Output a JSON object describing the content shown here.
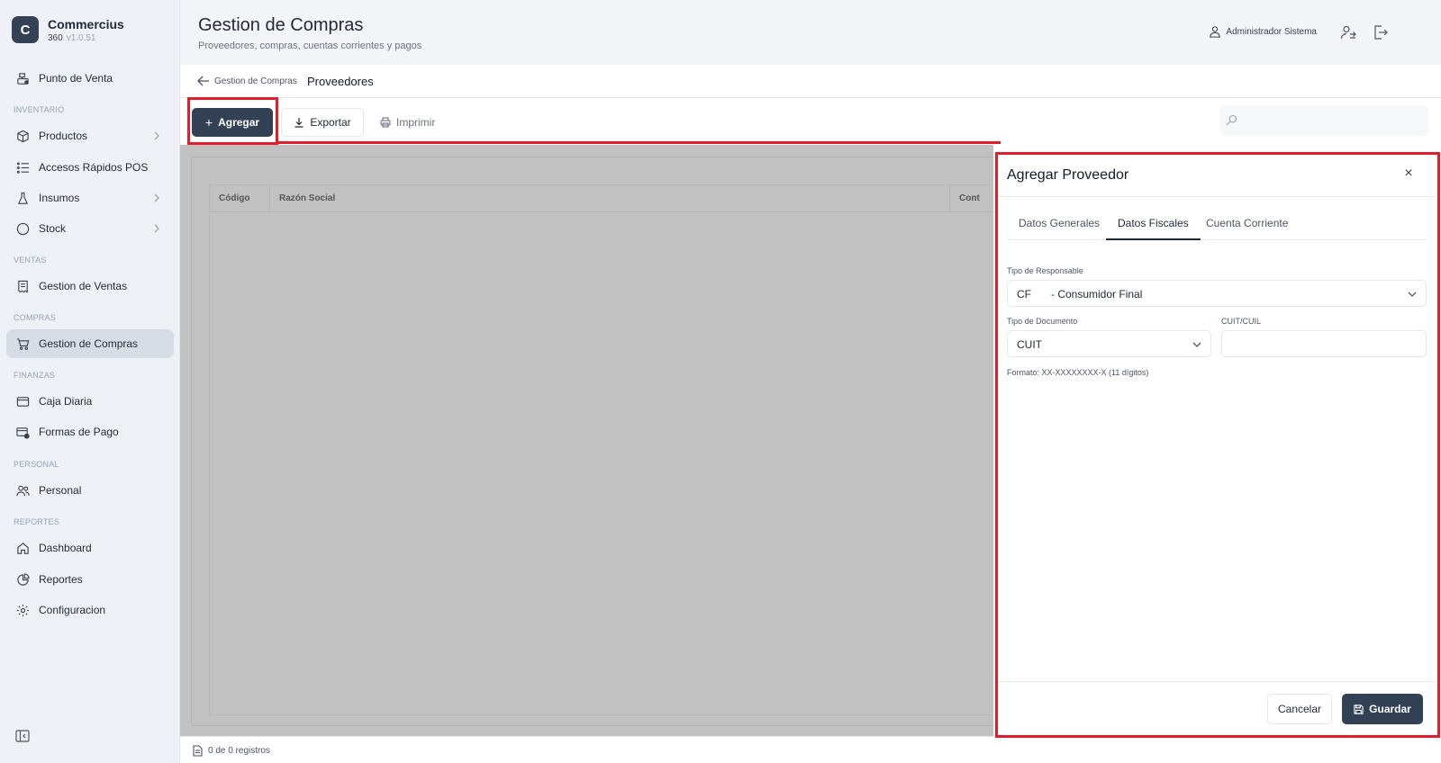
{
  "brand": {
    "initial": "C",
    "name": "Commercius",
    "edition": "360",
    "version": "v1.0.51"
  },
  "sidebar": {
    "point_of_sale": "Punto de Venta",
    "sections": {
      "inventario": "INVENTARIO",
      "ventas": "VENTAS",
      "compras": "COMPRAS",
      "finanzas": "FINANZAS",
      "personal": "PERSONAL",
      "reportes": "REPORTES"
    },
    "items": {
      "productos": "Productos",
      "accesos_rapidos": "Accesos Rápidos POS",
      "insumos": "Insumos",
      "stock": "Stock",
      "gestion_ventas": "Gestion de Ventas",
      "gestion_compras": "Gestion de Compras",
      "caja_diaria": "Caja Diaria",
      "formas_pago": "Formas de Pago",
      "personal": "Personal",
      "dashboard": "Dashboard",
      "reportes": "Reportes",
      "configuracion": "Configuracion"
    },
    "active_item": "gestion_compras"
  },
  "header": {
    "title": "Gestion de Compras",
    "subtitle": "Proveedores, compras, cuentas corrientes y pagos",
    "user_name": "Administrador Sistema"
  },
  "breadcrumb": {
    "back_label": "Gestion de Compras",
    "current": "Proveedores"
  },
  "toolbar": {
    "add_label": "Agregar",
    "export_label": "Exportar",
    "print_label": "Imprimir",
    "search_placeholder": ""
  },
  "table": {
    "columns": [
      "Código",
      "Razón Social",
      "Cont"
    ]
  },
  "footer": {
    "records_text": "0 de 0 registros"
  },
  "drawer": {
    "title": "Agregar Proveedor",
    "close_symbol": "×",
    "tabs": [
      "Datos Generales",
      "Datos Fiscales",
      "Cuenta Corriente"
    ],
    "active_tab": "Datos Fiscales",
    "fields": {
      "tipo_responsable_label": "Tipo de Responsable",
      "tipo_responsable_code": "CF",
      "tipo_responsable_desc": "- Consumidor Final",
      "tipo_documento_label": "Tipo de Documento",
      "tipo_documento_value": "CUIT",
      "cuit_label": "CUIT/CUIL",
      "cuit_value": "",
      "format_hint": "Formato: XX-XXXXXXXX-X (11 dígitos)"
    },
    "cancel_label": "Cancelar",
    "save_label": "Guardar"
  },
  "colors": {
    "primary": "#334155",
    "highlight": "#e11d2e",
    "sidebar_bg": "#eef1f5",
    "overlay": "#c1c1c1"
  }
}
